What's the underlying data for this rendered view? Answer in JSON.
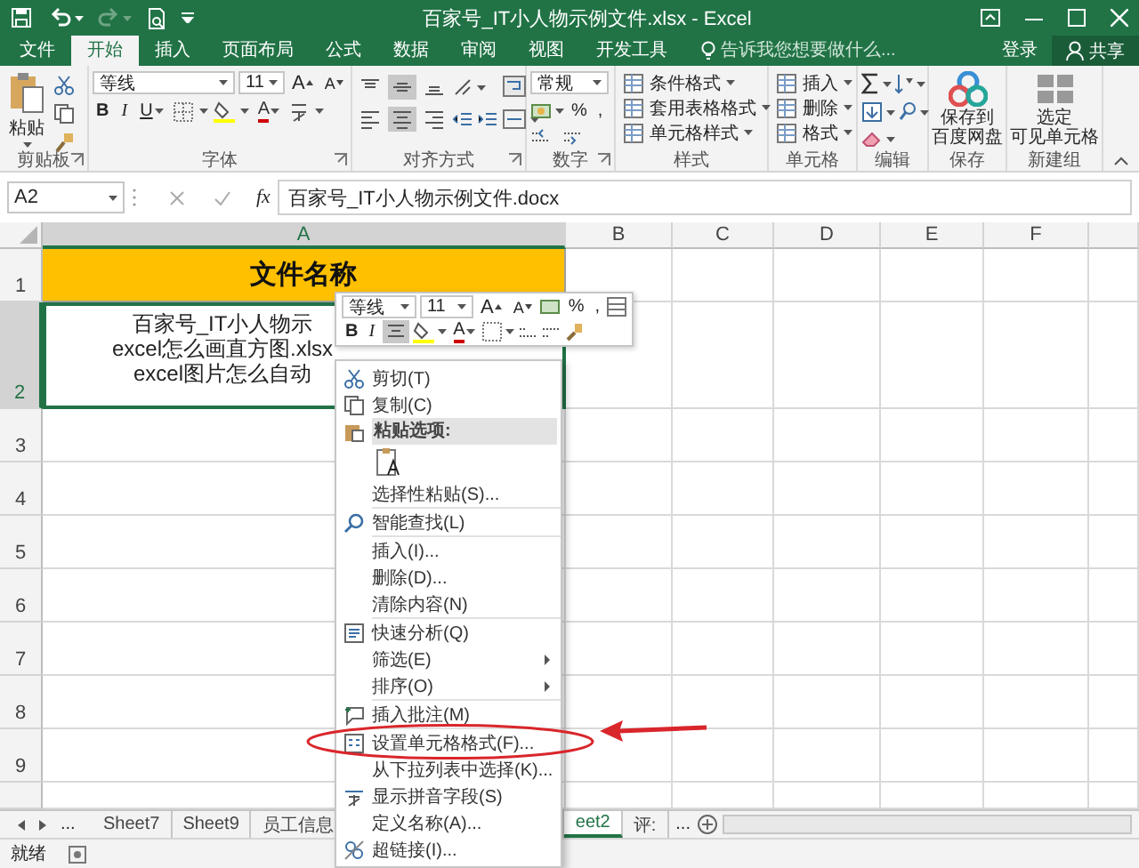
{
  "window": {
    "title": "百家号_IT小人物示例文件.xlsx - Excel"
  },
  "quick_access": {
    "redo_disabled": true
  },
  "ribbon_tabs": [
    {
      "label": "文件",
      "selected": false
    },
    {
      "label": "开始",
      "selected": true
    },
    {
      "label": "插入",
      "selected": false
    },
    {
      "label": "页面布局",
      "selected": false
    },
    {
      "label": "公式",
      "selected": false
    },
    {
      "label": "数据",
      "selected": false
    },
    {
      "label": "审阅",
      "selected": false
    },
    {
      "label": "视图",
      "selected": false
    },
    {
      "label": "开发工具",
      "selected": false
    }
  ],
  "tell_me": {
    "placeholder": "告诉我您想要做什么..."
  },
  "account": {
    "sign_in": "登录",
    "share": "共享"
  },
  "ribbon_groups": [
    {
      "kind": "clipboard",
      "label": "剪贴板",
      "paste": "粘贴",
      "launcher": true
    },
    {
      "kind": "font",
      "label": "字体",
      "font": "等线",
      "size": "11",
      "grow": "A",
      "shrink": "A",
      "bold": "B",
      "italic": "I",
      "underline": "U",
      "font_color": "A",
      "launcher": true
    },
    {
      "kind": "alignment",
      "label": "对齐方式",
      "vertical": [
        {
          "selected": false
        },
        {
          "selected": true
        },
        {
          "selected": false
        }
      ],
      "horizontal": [
        {
          "selected": false
        },
        {
          "selected": true
        },
        {
          "selected": false
        }
      ],
      "launcher": true
    },
    {
      "kind": "number",
      "label": "数字",
      "format": "常规",
      "percent": "%",
      "comma": ",",
      "launcher": true
    },
    {
      "kind": "list",
      "label": "样式",
      "items": [
        "条件格式",
        "套用表格格式",
        "单元格样式"
      ]
    },
    {
      "kind": "list",
      "label": "单元格",
      "items": [
        "插入",
        "删除",
        "格式"
      ]
    },
    {
      "kind": "editing",
      "label": "编辑"
    },
    {
      "kind": "big",
      "label": "保存",
      "lines": [
        "保存到",
        "百度网盘"
      ]
    },
    {
      "kind": "big",
      "label": "新建组",
      "lines": [
        "选定",
        "可见单元格"
      ]
    }
  ],
  "formula_bar": {
    "name_box": "A2",
    "function_label": "fx",
    "value": "百家号_IT小人物示例文件.docx"
  },
  "sheet": {
    "columns": [
      {
        "label": "A",
        "selected": true
      },
      {
        "label": "B",
        "selected": false
      },
      {
        "label": "C",
        "selected": false
      },
      {
        "label": "D",
        "selected": false
      },
      {
        "label": "E",
        "selected": false
      },
      {
        "label": "F",
        "selected": false
      }
    ],
    "rows": [
      {
        "label": "1",
        "selected": false
      },
      {
        "label": "2",
        "selected": true
      },
      {
        "label": "3",
        "selected": false
      },
      {
        "label": "4",
        "selected": false
      },
      {
        "label": "5",
        "selected": false
      },
      {
        "label": "6",
        "selected": false
      },
      {
        "label": "7",
        "selected": false
      },
      {
        "label": "8",
        "selected": false
      },
      {
        "label": "9",
        "selected": false
      }
    ],
    "a1": "文件名称",
    "a2": [
      "百家号_IT小人物示",
      "excel怎么画直方图.xlsx",
      "excel图片怎么自动"
    ]
  },
  "mini_toolbar": {
    "font": "等线",
    "size": "11",
    "grow": "A",
    "shrink": "A",
    "percent": "%",
    "comma": ",",
    "bold": "B",
    "italic": "I",
    "font_color": "A",
    "center_selected": true
  },
  "context_menu": [
    {
      "kind": "item",
      "label": "剪切(T)"
    },
    {
      "kind": "item",
      "label": "复制(C)"
    },
    {
      "kind": "header",
      "label": "粘贴选项:"
    },
    {
      "kind": "paste_option"
    },
    {
      "kind": "item",
      "label": "选择性粘贴(S)..."
    },
    {
      "kind": "separator"
    },
    {
      "kind": "item",
      "label": "智能查找(L)"
    },
    {
      "kind": "separator"
    },
    {
      "kind": "item",
      "label": "插入(I)..."
    },
    {
      "kind": "item",
      "label": "删除(D)..."
    },
    {
      "kind": "item",
      "label": "清除内容(N)"
    },
    {
      "kind": "separator"
    },
    {
      "kind": "item",
      "label": "快速分析(Q)"
    },
    {
      "kind": "item",
      "label": "筛选(E)",
      "submenu": true
    },
    {
      "kind": "item",
      "label": "排序(O)",
      "submenu": true
    },
    {
      "kind": "separator"
    },
    {
      "kind": "item",
      "label": "插入批注(M)"
    },
    {
      "kind": "separator"
    },
    {
      "kind": "item",
      "label": "设置单元格格式(F)..."
    },
    {
      "kind": "item",
      "label": "从下拉列表中选择(K)..."
    },
    {
      "kind": "item",
      "label": "显示拼音字段(S)"
    },
    {
      "kind": "item",
      "label": "定义名称(A)..."
    },
    {
      "kind": "item",
      "label": "超链接(I)..."
    }
  ],
  "sheet_tabs": {
    "more_left": "...",
    "tabs": [
      {
        "label": "Sheet7",
        "selected": false
      },
      {
        "label": "Sheet9",
        "selected": false
      },
      {
        "label": "员工信息",
        "selected": false
      },
      {
        "label": "eet2",
        "selected": true
      },
      {
        "label": "评:",
        "selected": false
      }
    ],
    "more_right": "..."
  },
  "status_bar": {
    "status": "就绪"
  }
}
